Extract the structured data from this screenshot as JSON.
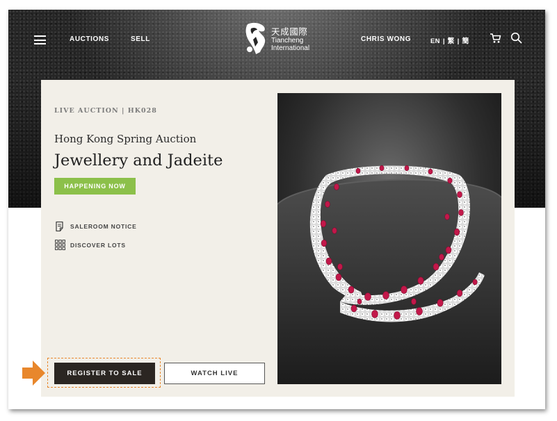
{
  "header": {
    "nav": [
      {
        "label": "AUCTIONS"
      },
      {
        "label": "SELL"
      }
    ],
    "logo": {
      "chinese": "天成國際",
      "english_line1": "Tiancheng",
      "english_line2": "International"
    },
    "user_name": "CHRIS WONG",
    "languages": [
      "EN",
      "繁",
      "簡"
    ],
    "icons": [
      "menu-icon",
      "cart-icon",
      "search-icon"
    ]
  },
  "auction": {
    "eyebrow": "LIVE AUCTION | HK028",
    "subtitle": "Hong Kong Spring Auction",
    "title": "Jewellery and Jadeite",
    "status_badge": "HAPPENING NOW",
    "links": [
      {
        "label": "SALEROOM NOTICE",
        "icon": "document-icon"
      },
      {
        "label": "DISCOVER LOTS",
        "icon": "grid-icon"
      }
    ],
    "register_label": "REGISTER TO SALE",
    "watch_label": "WATCH LIVE"
  },
  "colors": {
    "badge_green": "#8cc04a",
    "card_cream": "#f2efe8",
    "register_dark": "#2b2622",
    "annotation_orange": "#e8872c",
    "ruby_red": "#c2184a"
  }
}
